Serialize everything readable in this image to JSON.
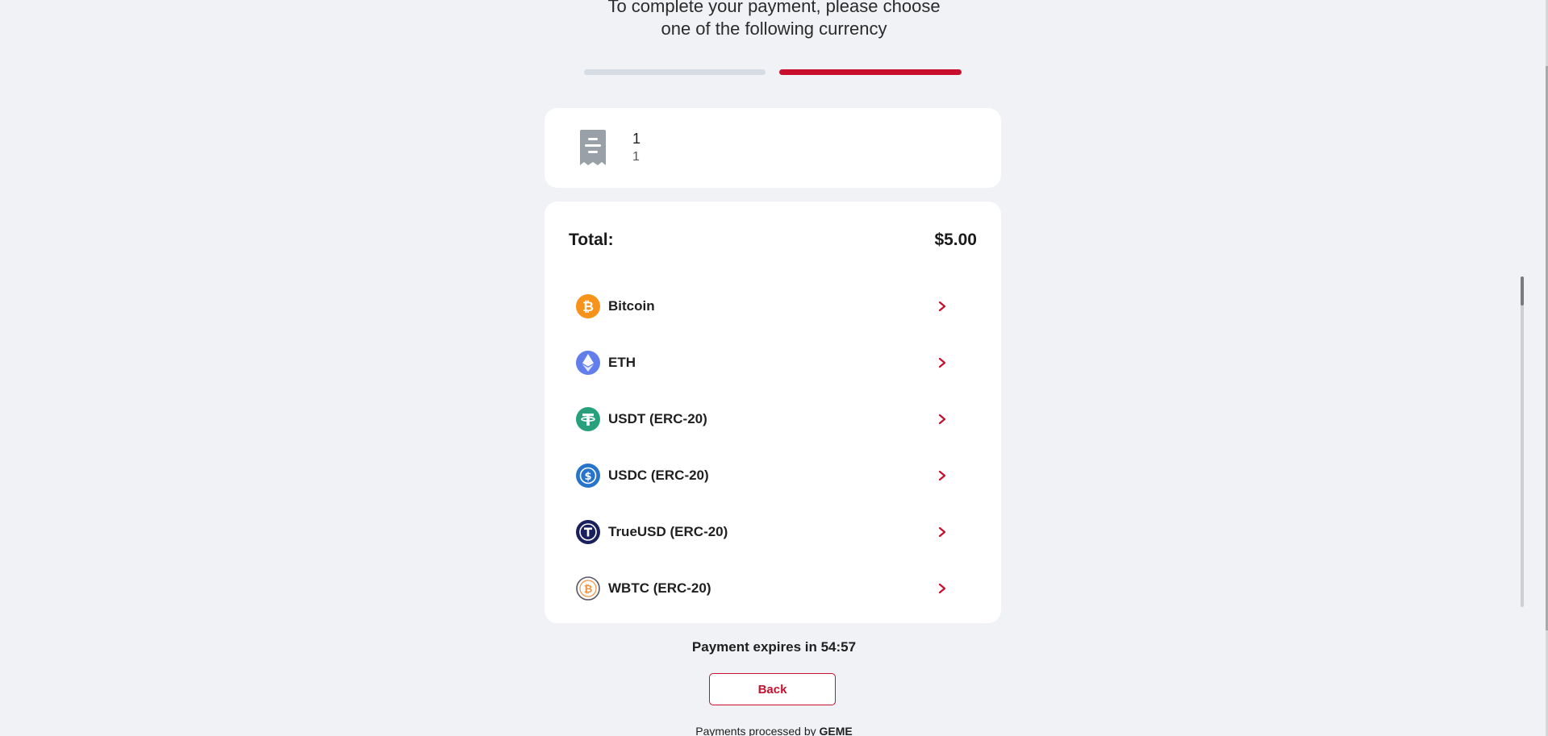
{
  "header": {
    "line1": "To complete your payment, please choose",
    "line2": "one of the following currency"
  },
  "progress": {
    "total_steps": 2,
    "current_step": 2,
    "inactive_color": "#d6dce3",
    "active_color": "#c8102e"
  },
  "order": {
    "icon": "receipt-icon",
    "title": "1",
    "subtitle": "1"
  },
  "payment": {
    "total_label": "Total:",
    "total_value": "$5.00",
    "currencies": [
      {
        "name": "Bitcoin",
        "icon": "bitcoin-icon",
        "color": "#f7931a"
      },
      {
        "name": "ETH",
        "icon": "ethereum-icon",
        "color": "#627eea"
      },
      {
        "name": "USDT (ERC-20)",
        "icon": "tether-icon",
        "color": "#26a17b"
      },
      {
        "name": "USDC (ERC-20)",
        "icon": "usdc-icon",
        "color": "#2775ca"
      },
      {
        "name": "TrueUSD (ERC-20)",
        "icon": "trueusd-icon",
        "color": "#1a1f5e"
      },
      {
        "name": "WBTC (ERC-20)",
        "icon": "wbtc-icon",
        "color": "#f09242"
      }
    ]
  },
  "footer": {
    "expires_text": "Payment expires in 54:57",
    "back_label": "Back",
    "processed_prefix": "Payments processed by ",
    "processed_brand": "GEME"
  },
  "colors": {
    "accent": "#c8102e",
    "background": "#f0f2f5",
    "card": "#ffffff"
  }
}
